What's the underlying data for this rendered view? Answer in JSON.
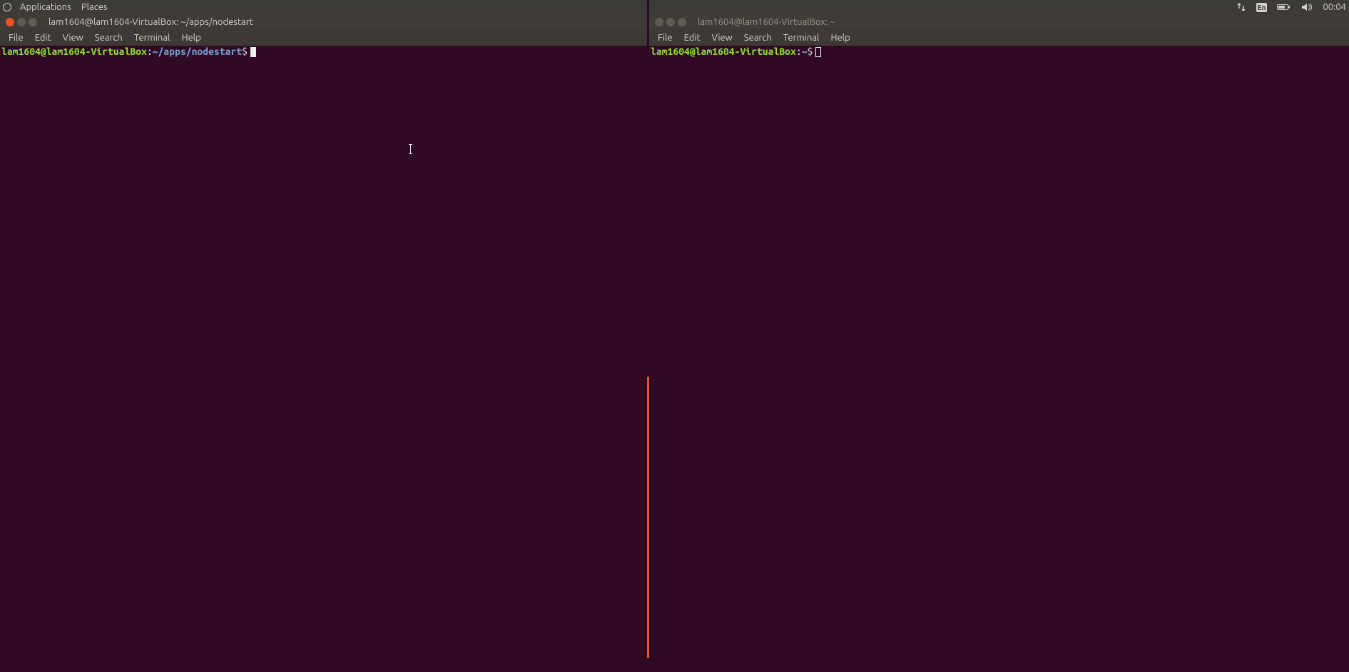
{
  "panel": {
    "applications": "Applications",
    "places": "Places",
    "input_method": "En",
    "clock": "00:04"
  },
  "windows": [
    {
      "title": "lam1604@lam1604-VirtualBox: ~/apps/nodestart",
      "active": true,
      "menubar": [
        "File",
        "Edit",
        "View",
        "Search",
        "Terminal",
        "Help"
      ],
      "prompt": {
        "user_host": "lam1604@lam1604-VirtualBox",
        "sep": ":",
        "path": "~/apps/nodestart",
        "dollar": "$"
      },
      "cursor_style": "block"
    },
    {
      "title": "lam1604@lam1604-VirtualBox: ~",
      "active": false,
      "menubar": [
        "File",
        "Edit",
        "View",
        "Search",
        "Terminal",
        "Help"
      ],
      "prompt": {
        "user_host": "lam1604@lam1604-VirtualBox",
        "sep": ":",
        "path": "~",
        "dollar": "$"
      },
      "cursor_style": "outline"
    }
  ]
}
